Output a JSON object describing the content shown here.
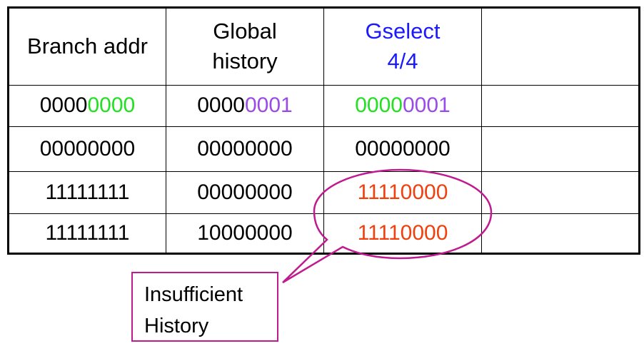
{
  "colors": {
    "header_gselect": "#1a1aff",
    "low_bits_green": "#22e022",
    "history_purple": "#9a4ae8",
    "result_red": "#f0400e",
    "callout_magenta": "#c01a8f"
  },
  "table": {
    "headers": {
      "branch_addr": "Branch addr",
      "global_history_line1": "Global",
      "global_history_line2": "history",
      "gselect_line1": "Gselect",
      "gselect_line2": "4/4",
      "extra": ""
    },
    "rows": [
      {
        "branch_prefix": "0000",
        "branch_suffix": "0000",
        "history_prefix": "0000",
        "history_suffix": "0001",
        "gselect_prefix": "0000",
        "gselect_suffix": "0001",
        "extra": ""
      },
      {
        "branch_addr": "00000000",
        "global_history": "00000000",
        "gselect": "00000000",
        "extra": ""
      },
      {
        "branch_addr": "11111111",
        "global_history": "00000000",
        "gselect": "11110000",
        "extra": ""
      },
      {
        "branch_addr": "11111111",
        "global_history": "10000000",
        "gselect": "11110000",
        "extra": ""
      }
    ]
  },
  "callout": {
    "line1": "Insufficient",
    "line2": "History"
  }
}
